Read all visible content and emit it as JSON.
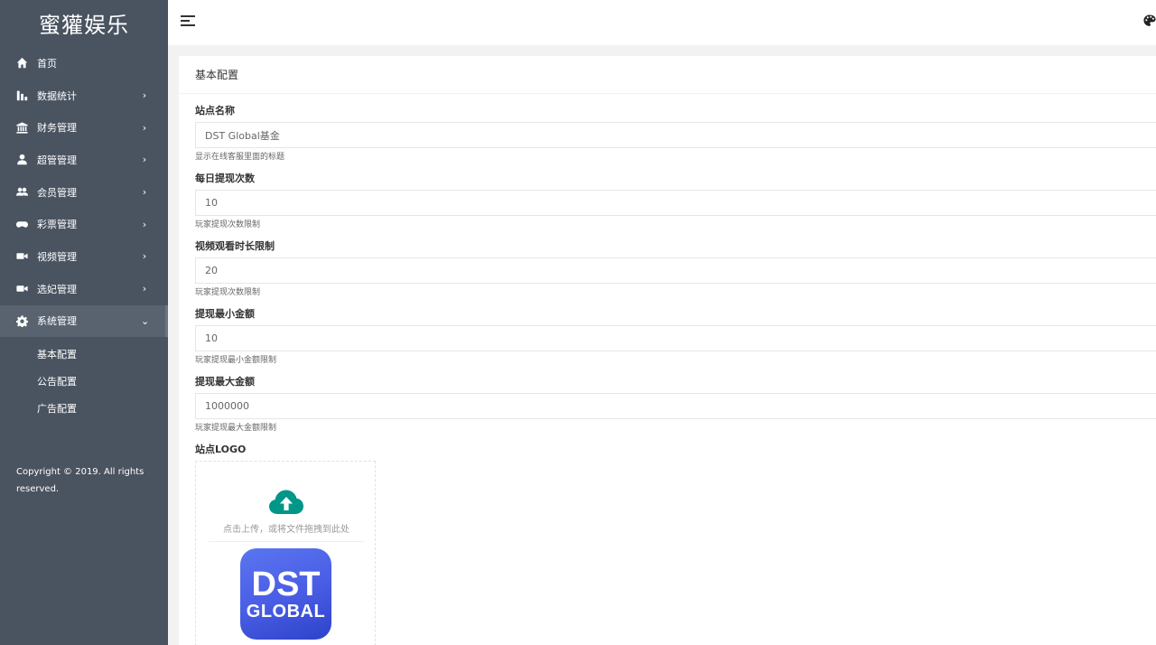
{
  "sidebar": {
    "brand": "蜜獾娱乐",
    "items": [
      {
        "label": "首页",
        "icon": "home-icon",
        "arrow": ""
      },
      {
        "label": "数据统计",
        "icon": "bar-chart-icon",
        "arrow": "›"
      },
      {
        "label": "财务管理",
        "icon": "bank-icon",
        "arrow": "›"
      },
      {
        "label": "超管管理",
        "icon": "user-icon",
        "arrow": "›"
      },
      {
        "label": "会员管理",
        "icon": "users-icon",
        "arrow": "›"
      },
      {
        "label": "彩票管理",
        "icon": "gamepad-icon",
        "arrow": "›"
      },
      {
        "label": "视频管理",
        "icon": "video-camera-icon",
        "arrow": "›"
      },
      {
        "label": "选妃管理",
        "icon": "video-camera-icon",
        "arrow": "›"
      },
      {
        "label": "系统管理",
        "icon": "gear-icon",
        "arrow": "⌄"
      }
    ],
    "subitems": [
      "基本配置",
      "公告配置",
      "广告配置"
    ],
    "copyright": "Copyright © 2019. All rights reserved."
  },
  "header": {
    "menu_icon": "menu-icon",
    "theme_icon": "palette-icon"
  },
  "main": {
    "title": "基本配置",
    "fields": [
      {
        "label": "站点名称",
        "value": "DST Global基金",
        "help": "显示在线客服里面的标题"
      },
      {
        "label": "每日提现次数",
        "value": "10",
        "help": "玩家提现次数限制"
      },
      {
        "label": "视频观看时长限制",
        "value": "20",
        "help": "玩家提现次数限制"
      },
      {
        "label": "提现最小金额",
        "value": "10",
        "help": "玩家提现最小金额限制"
      },
      {
        "label": "提现最大金额",
        "value": "1000000",
        "help": "玩家提现最大金额限制"
      }
    ],
    "logo": {
      "label": "站点LOGO",
      "upload_text": "点击上传，或将文件拖拽到此处",
      "logo_line1": "DST",
      "logo_line2": "GLOBAL",
      "accent": "#009688"
    }
  }
}
